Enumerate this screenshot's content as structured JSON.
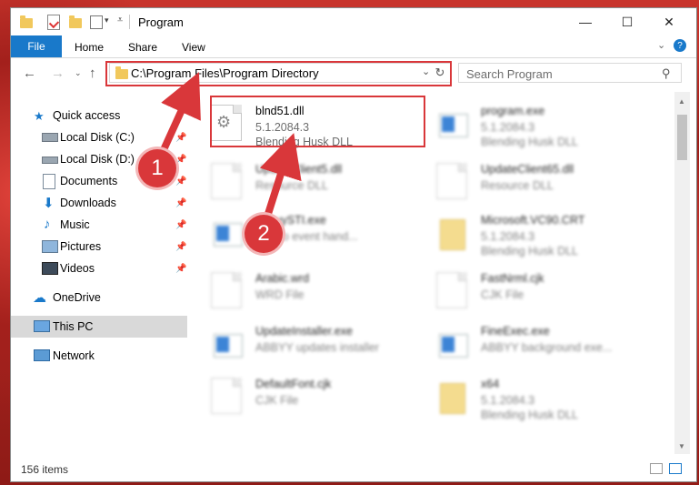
{
  "window": {
    "title": "Program"
  },
  "ribbon": {
    "file": "File",
    "tabs": [
      "Home",
      "Share",
      "View"
    ]
  },
  "address": {
    "path": "C:\\Program Files\\Program Directory"
  },
  "search": {
    "placeholder": "Search Program"
  },
  "nav": {
    "quick_access": "Quick access",
    "items": [
      {
        "label": "Local Disk (C:)",
        "icon": "drive-icon"
      },
      {
        "label": "Local Disk (D:)",
        "icon": "drive-icon"
      },
      {
        "label": "Documents",
        "icon": "documents-icon"
      },
      {
        "label": "Downloads",
        "icon": "downloads-icon"
      },
      {
        "label": "Music",
        "icon": "music-icon"
      },
      {
        "label": "Pictures",
        "icon": "pictures-icon"
      },
      {
        "label": "Videos",
        "icon": "videos-icon"
      }
    ],
    "onedrive": "OneDrive",
    "this_pc": "This PC",
    "network": "Network"
  },
  "files": [
    {
      "name": "blnd51.dll",
      "line2": "5.1.2084.3",
      "line3": "Blending Husk DLL"
    },
    {
      "name": "program.exe",
      "line2": "5.1.2084.3",
      "line3": "Blending Husk DLL"
    },
    {
      "name": "UpdateClient5.dll",
      "line2": "Resource DLL",
      "line3": ""
    },
    {
      "name": "UpdateClient65.dll",
      "line2": "Resource DLL",
      "line3": ""
    },
    {
      "name": "AbbyySTI.exe",
      "line2": "STI do event hand...",
      "line3": ""
    },
    {
      "name": "Microsoft.VC90.CRT",
      "line2": "5.1.2084.3",
      "line3": "Blending Husk DLL"
    },
    {
      "name": "Arabic.wrd",
      "line2": "WRD File",
      "line3": ""
    },
    {
      "name": "FastNrml.cjk",
      "line2": "CJK File",
      "line3": ""
    },
    {
      "name": "UpdateInstaller.exe",
      "line2": "ABBYY updates installer",
      "line3": ""
    },
    {
      "name": "FineExec.exe",
      "line2": "ABBYY background exe...",
      "line3": ""
    },
    {
      "name": "DefaultFont.cjk",
      "line2": "CJK File",
      "line3": ""
    },
    {
      "name": "x64",
      "line2": "5.1.2084.3",
      "line3": "Blending Husk DLL"
    }
  ],
  "status": {
    "count": "156 items"
  },
  "annotations": {
    "step1": "1",
    "step2": "2"
  },
  "colors": {
    "accent": "#1979ca",
    "annotation_red": "#d9373a"
  }
}
